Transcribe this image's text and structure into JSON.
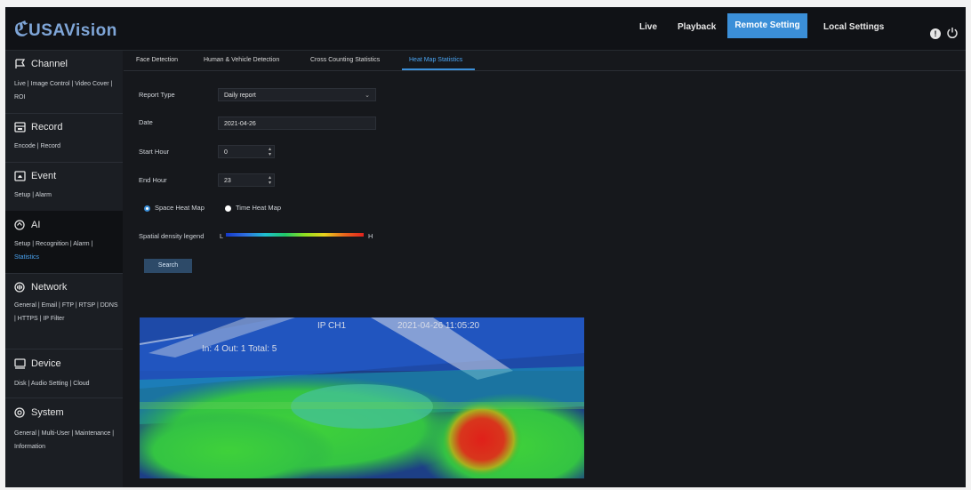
{
  "brand": {
    "logo_text": "USAVision"
  },
  "top_nav": {
    "items": [
      "Live",
      "Playback",
      "Remote Setting",
      "Local Settings"
    ],
    "active": "Remote Setting"
  },
  "sidebar": {
    "sections": [
      {
        "title": "Channel",
        "icon": "channel-icon",
        "links": "Live | Image Control | Video Cover | ROI"
      },
      {
        "title": "Record",
        "icon": "record-icon",
        "links": "Encode | Record"
      },
      {
        "title": "Event",
        "icon": "event-icon",
        "links": "Setup | Alarm"
      },
      {
        "title": "AI",
        "icon": "ai-icon",
        "links": "Setup | Recognition | Alarm |",
        "highlight": "Statistics"
      },
      {
        "title": "Network",
        "icon": "network-icon",
        "links": "General | Email | FTP | RTSP | DDNS | HTTPS | IP Filter"
      },
      {
        "title": "Device",
        "icon": "device-icon",
        "links": "Disk | Audio Setting | Cloud"
      },
      {
        "title": "System",
        "icon": "system-icon",
        "links": "General | Multi-User | Maintenance | Information"
      }
    ]
  },
  "tabs": [
    "Face Detection",
    "Human & Vehicle Detection",
    "Cross Counting Statistics",
    "Heat Map Statistics"
  ],
  "form": {
    "report_type_label": "Report Type",
    "report_type_value": "Daily report",
    "date_label": "Date",
    "date_value": "2021-04-26",
    "start_hour_label": "Start Hour",
    "start_hour_value": "0",
    "end_hour_label": "End Hour",
    "end_hour_value": "23",
    "radio_space": "Space Heat Map",
    "radio_time": "Time Heat Map",
    "legend_label": "Spatial density legend",
    "legend_low": "L",
    "legend_high": "H",
    "search_label": "Search"
  },
  "heatmap": {
    "osd_channel": "IP CH1",
    "osd_datetime": "2021-04-26 11:05:20",
    "osd_counts": "In: 4 Out: 1 Total: 5"
  },
  "colors": {
    "accent": "#3b8fd8",
    "background": "#16181c"
  }
}
